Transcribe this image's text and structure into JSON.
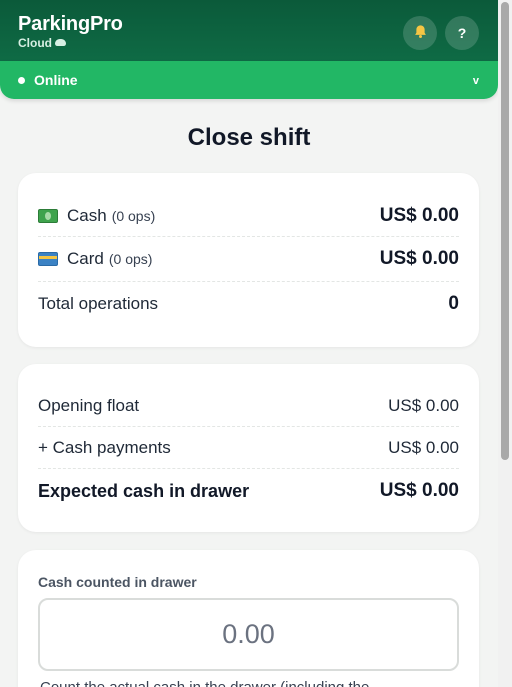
{
  "header": {
    "brand_name": "ParkingPro",
    "brand_sub": "Cloud",
    "bell_icon": "bell-icon",
    "help_label": "?"
  },
  "status": {
    "label": "Online",
    "chevron": "v"
  },
  "page": {
    "title": "Close shift"
  },
  "totals": {
    "cash": {
      "label": "Cash",
      "ops": "(0 ops)",
      "value": "US$ 0.00",
      "icon": "cash-icon"
    },
    "card": {
      "label": "Card",
      "ops": "(0 ops)",
      "value": "US$ 0.00",
      "icon": "card-icon"
    },
    "total_operations": {
      "label": "Total operations",
      "value": "0"
    }
  },
  "drawer": {
    "opening_float": {
      "label": "Opening float",
      "value": "US$ 0.00"
    },
    "cash_payments": {
      "label": "+ Cash payments",
      "value": "US$ 0.00"
    },
    "expected": {
      "label": "Expected cash in drawer",
      "value": "US$ 0.00"
    }
  },
  "count": {
    "label": "Cash counted in drawer",
    "placeholder": "0.00",
    "value": "",
    "hint": "Count the actual cash in the drawer (including the"
  },
  "colors": {
    "header_bg": "#0f6b45",
    "status_bg": "#22b765",
    "page_bg": "#f3f4f3",
    "card_bg": "#ffffff"
  }
}
